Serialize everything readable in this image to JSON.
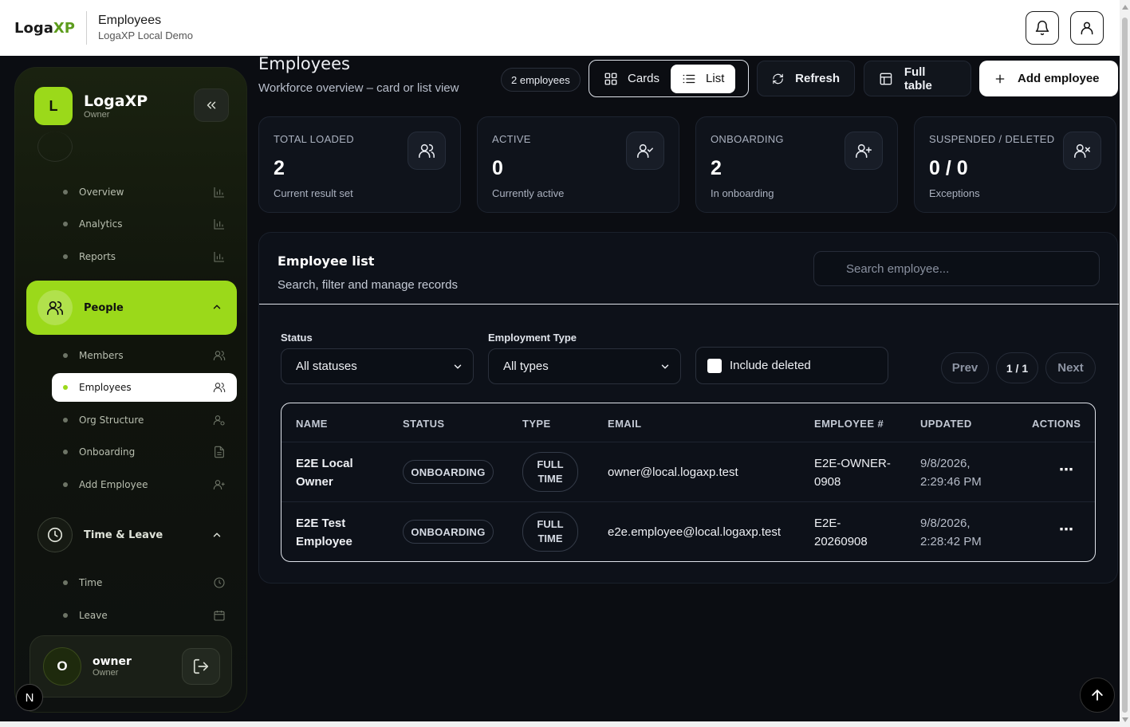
{
  "header": {
    "logo_text": "Loga",
    "logo_accent": "XP",
    "title": "Employees",
    "subtitle": "LogaXP Local Demo",
    "icons": [
      "bell-icon",
      "user-icon"
    ]
  },
  "sidebar": {
    "brand": {
      "avatar": "L",
      "name": "LogaXP",
      "role": "Owner"
    },
    "items": [
      {
        "label": "Overview",
        "icon": "bar-chart-icon"
      },
      {
        "label": "Analytics",
        "icon": "bar-chart-icon"
      },
      {
        "label": "Reports",
        "icon": "bar-chart-icon"
      }
    ],
    "people_group": {
      "label": "People",
      "expanded": true
    },
    "people_items": [
      {
        "label": "Members",
        "icon": "users-icon"
      },
      {
        "label": "Employees",
        "icon": "users-icon",
        "active": true
      },
      {
        "label": "Org Structure",
        "icon": "user-settings-icon"
      },
      {
        "label": "Onboarding",
        "icon": "document-icon"
      },
      {
        "label": "Add Employee",
        "icon": "user-plus-icon"
      }
    ],
    "time_group": {
      "label": "Time & Leave",
      "expanded": true
    },
    "time_items": [
      {
        "label": "Time",
        "icon": "clock-icon"
      },
      {
        "label": "Leave",
        "icon": "calendar-icon"
      }
    ],
    "user": {
      "avatar": "O",
      "name": "owner",
      "role": "Owner"
    },
    "badge": "N"
  },
  "page": {
    "title": "Employees",
    "subtitle": "Workforce overview – card or list view",
    "count": "2 employees",
    "view_cards": "Cards",
    "view_list": "List",
    "active_view": "List",
    "refresh": "Refresh",
    "full_table": "Full table",
    "add_employee": "Add employee"
  },
  "stats": [
    {
      "label": "TOTAL LOADED",
      "value": "2",
      "desc": "Current result set",
      "icon": "users-icon"
    },
    {
      "label": "ACTIVE",
      "value": "0",
      "desc": "Currently active",
      "icon": "user-check-icon"
    },
    {
      "label": "ONBOARDING",
      "value": "2",
      "desc": "In onboarding",
      "icon": "user-plus-icon"
    },
    {
      "label": "SUSPENDED / DELETED",
      "value": "0 / 0",
      "desc": "Exceptions",
      "icon": "user-x-icon"
    }
  ],
  "list": {
    "title": "Employee list",
    "subtitle": "Search, filter and manage records",
    "search_placeholder": "Search employee...",
    "status_label": "Status",
    "status_value": "All statuses",
    "type_label": "Employment Type",
    "type_value": "All types",
    "include_deleted": "Include deleted",
    "prev": "Prev",
    "page": "1 / 1",
    "next": "Next",
    "columns": [
      "NAME",
      "STATUS",
      "TYPE",
      "EMAIL",
      "EMPLOYEE #",
      "UPDATED",
      "ACTIONS"
    ],
    "rows": [
      {
        "name1": "E2E Local",
        "name2": "Owner",
        "status": "ONBOARDING",
        "type1": "FULL",
        "type2": "TIME",
        "email": "owner@local.logaxp.test",
        "emp1": "E2E-OWNER-",
        "emp2": "0908",
        "upd1": "9/8/2026,",
        "upd2": "2:29:46 PM",
        "actions": "⋯"
      },
      {
        "name1": "E2E Test",
        "name2": "Employee",
        "status": "ONBOARDING",
        "type1": "FULL",
        "type2": "TIME",
        "email": "e2e.employee@local.logaxp.test",
        "emp1": "E2E-",
        "emp2": "20260908",
        "upd1": "9/8/2026,",
        "upd2": "2:28:42 PM",
        "actions": "⋯"
      }
    ]
  },
  "colors": {
    "accent": "#9bd91a",
    "background": "#0b0d12",
    "card": "#0f131b"
  }
}
